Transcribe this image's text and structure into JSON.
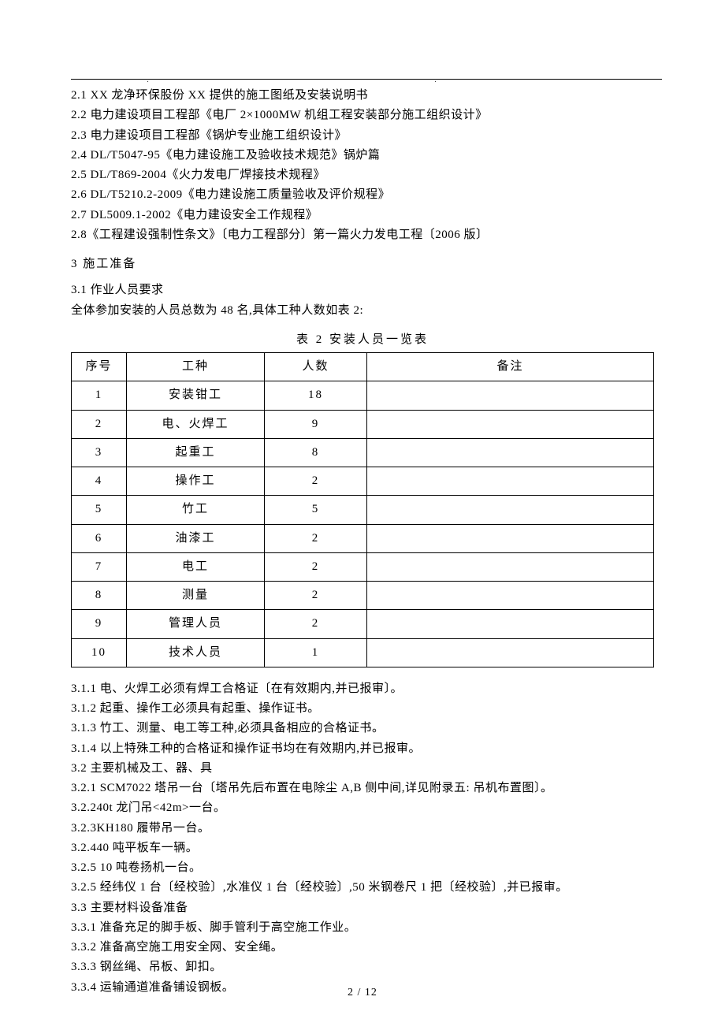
{
  "refs": [
    "2.1 XX 龙净环保股份 XX 提供的施工图纸及安装说明书",
    "2.2   电力建设项目工程部《电厂 2×1000MW 机组工程安装部分施工组织设计》",
    "2.3 电力建设项目工程部《锅炉专业施工组织设计》",
    "2.4 DL/T5047-95《电力建设施工及验收技术规范》锅炉篇",
    "2.5 DL/T869-2004《火力发电厂焊接技术规程》",
    "2.6 DL/T5210.2-2009《电力建设施工质量验收及评价规程》",
    "2.7 DL5009.1-2002《电力建设安全工作规程》",
    "2.8《工程建设强制性条文》〔电力工程部分〕第一篇火力发电工程〔2006 版〕"
  ],
  "sec3": {
    "head": "3 施工准备",
    "p31a": "3.1 作业人员要求",
    "p31b": "全体参加安装的人员总数为 48 名,具体工种人数如表 2:"
  },
  "table": {
    "caption": "表 2 安装人员一览表",
    "headers": {
      "seq": "序号",
      "type": "工种",
      "count": "人数",
      "remark": "备注"
    },
    "rows": [
      {
        "seq": "1",
        "type": "安装钳工",
        "count": "18",
        "remark": ""
      },
      {
        "seq": "2",
        "type": "电、火焊工",
        "count": "9",
        "remark": ""
      },
      {
        "seq": "3",
        "type": "起重工",
        "count": "8",
        "remark": ""
      },
      {
        "seq": "4",
        "type": "操作工",
        "count": "2",
        "remark": ""
      },
      {
        "seq": "5",
        "type": "竹工",
        "count": "5",
        "remark": ""
      },
      {
        "seq": "6",
        "type": "油漆工",
        "count": "2",
        "remark": ""
      },
      {
        "seq": "7",
        "type": "电工",
        "count": "2",
        "remark": ""
      },
      {
        "seq": "8",
        "type": "测量",
        "count": "2",
        "remark": ""
      },
      {
        "seq": "9",
        "type": "管理人员",
        "count": "2",
        "remark": ""
      },
      {
        "seq": "10",
        "type": "技术人员",
        "count": "1",
        "remark": ""
      }
    ]
  },
  "after": [
    "3.1.1   电、火焊工必须有焊工合格证〔在有效期内,并已报审〕。",
    "3.1.2 起重、操作工必须具有起重、操作证书。",
    "3.1.3 竹工、测量、电工等工种,必须具备相应的合格证书。",
    "3.1.4   以上特殊工种的合格证和操作证书均在有效期内,并已报审。",
    "3.2 主要机械及工、器、具",
    "3.2.1 SCM7022 塔吊一台〔塔吊先后布置在电除尘 A,B 侧中间,详见附录五: 吊机布置图〕。",
    "3.2.240t 龙门吊<42m>一台。",
    "3.2.3KH180 履带吊一台。",
    "3.2.440 吨平板车一辆。",
    "3.2.5   10 吨卷扬机一台。",
    "3.2.5 经纬仪 1 台〔经校验〕,水准仪 1 台〔经校验〕,50 米钢卷尺 1 把〔经校验〕,并已报审。",
    "3.3 主要材料设备准备",
    "3.3.1 准备充足的脚手板、脚手管利于高空施工作业。",
    "3.3.2 准备高空施工用安全网、安全绳。",
    "3.3.3 钢丝绳、吊板、卸扣。",
    "3.3.4 运输通道准备铺设钢板。"
  ],
  "footer": "2 / 12"
}
